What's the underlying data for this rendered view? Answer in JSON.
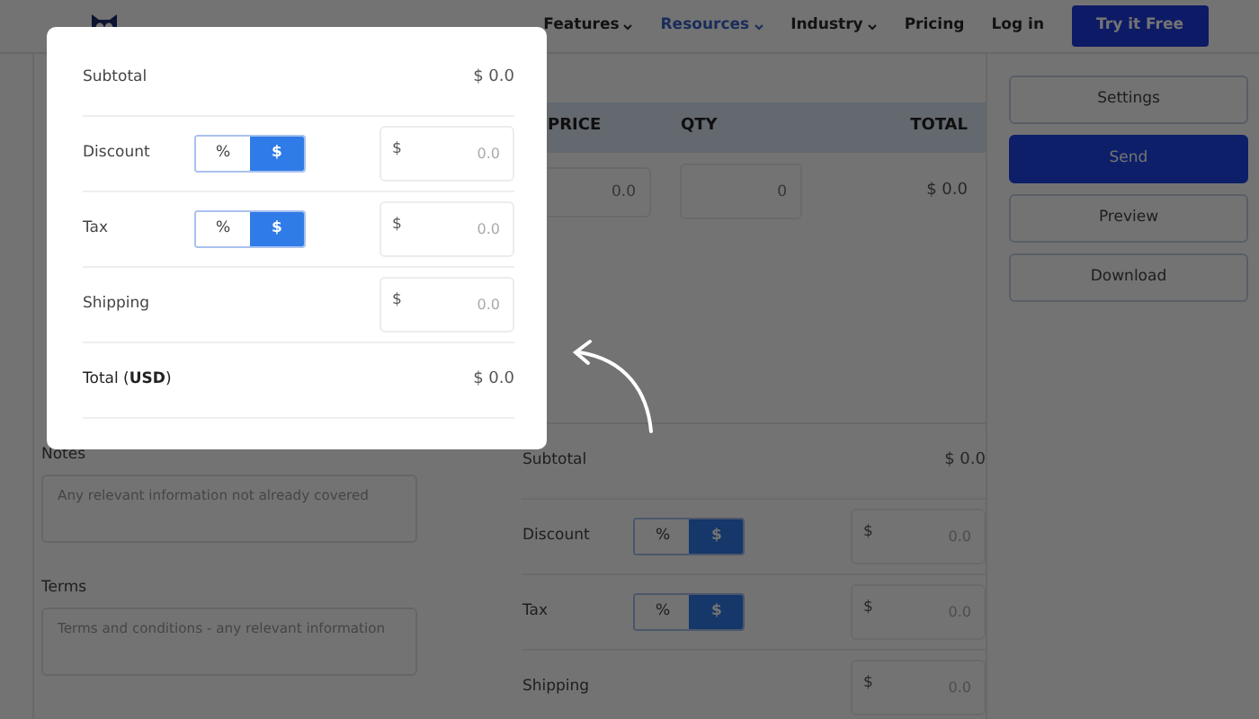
{
  "navbar": {
    "links": [
      {
        "label": "Features",
        "dropdown": true,
        "selected": false
      },
      {
        "label": "Resources",
        "dropdown": true,
        "selected": true
      },
      {
        "label": "Industry",
        "dropdown": true,
        "selected": false
      },
      {
        "label": "Pricing",
        "dropdown": false,
        "selected": false
      },
      {
        "label": "Log in",
        "dropdown": false,
        "selected": false
      }
    ],
    "cta": "Try it Free"
  },
  "items_table": {
    "columns": [
      "PRICE",
      "QTY",
      "TOTAL"
    ],
    "row": {
      "price_placeholder": "0.0",
      "qty_placeholder": "0",
      "total": "$ 0.0"
    }
  },
  "actions": [
    {
      "label": "Settings",
      "kind": "outline"
    },
    {
      "label": "Send",
      "kind": "primary"
    },
    {
      "label": "Preview",
      "kind": "outline"
    },
    {
      "label": "Download",
      "kind": "outline"
    }
  ],
  "notes": {
    "label": "Notes",
    "placeholder": "Any relevant information not already covered"
  },
  "terms": {
    "label": "Terms",
    "placeholder": "Terms and conditions - any relevant information"
  },
  "summary": {
    "subtotal": {
      "label": "Subtotal",
      "value": "$ 0.0"
    },
    "adjustments": [
      {
        "label": "Discount",
        "kind": "toggle",
        "options": [
          {
            "label": "%",
            "selected": false
          },
          {
            "label": "$",
            "selected": true
          }
        ],
        "currency": "$",
        "placeholder": "0.0"
      },
      {
        "label": "Tax",
        "kind": "toggle",
        "options": [
          {
            "label": "%",
            "selected": false
          },
          {
            "label": "$",
            "selected": true
          }
        ],
        "currency": "$",
        "placeholder": "0.0"
      },
      {
        "label": "Shipping",
        "kind": "plain",
        "currency": "$",
        "placeholder": "0.0"
      }
    ]
  },
  "popup": {
    "subtotal": {
      "label": "Subtotal",
      "value": "$ 0.0"
    },
    "adjustments": [
      {
        "label": "Discount",
        "kind": "toggle",
        "options": [
          {
            "label": "%",
            "selected": false
          },
          {
            "label": "$",
            "selected": true
          }
        ],
        "currency": "$",
        "placeholder": "0.0"
      },
      {
        "label": "Tax",
        "kind": "toggle",
        "options": [
          {
            "label": "%",
            "selected": false
          },
          {
            "label": "$",
            "selected": true
          }
        ],
        "currency": "$",
        "placeholder": "0.0"
      },
      {
        "label": "Shipping",
        "kind": "plain",
        "currency": "$",
        "placeholder": "0.0"
      }
    ],
    "total": {
      "label": "Total (**USD**)",
      "value": "$ 0.0"
    }
  }
}
